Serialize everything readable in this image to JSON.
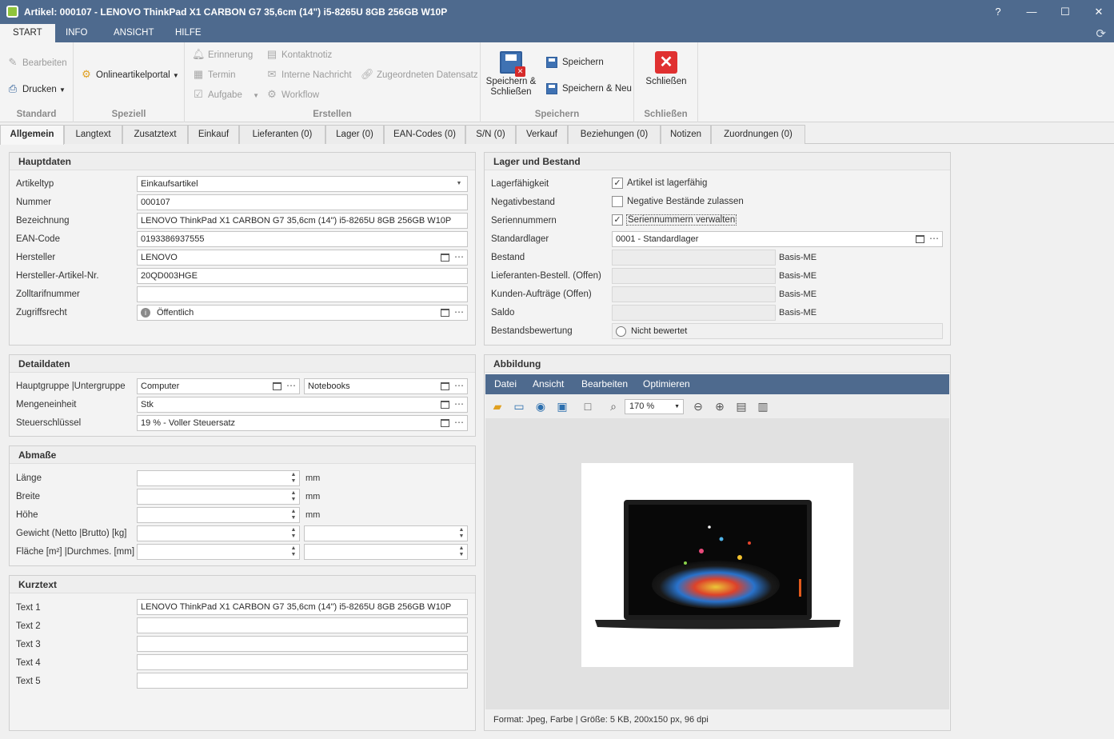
{
  "window": {
    "title": "Artikel: 000107 - LENOVO ThinkPad X1 CARBON G7 35,6cm (14\") i5-8265U 8GB 256GB W10P"
  },
  "menu": {
    "items": [
      {
        "label": "START"
      },
      {
        "label": "INFO"
      },
      {
        "label": "ANSICHT"
      },
      {
        "label": "HILFE"
      }
    ]
  },
  "ribbon": {
    "standard": {
      "title": "Standard",
      "edit": "Bearbeiten",
      "print": "Drucken"
    },
    "speziell": {
      "title": "Speziell",
      "portal": "Onlineartikelportal"
    },
    "erstellen": {
      "title": "Erstellen",
      "reminder": "Erinnerung",
      "appointment": "Termin",
      "task": "Aufgabe",
      "contact_note": "Kontaktnotiz",
      "internal_message": "Interne Nachricht",
      "assigned_record": "Zugeordneten Datensatz",
      "workflow": "Workflow"
    },
    "speichern": {
      "title": "Speichern",
      "save_close": "Speichern & Schließen",
      "save": "Speichern",
      "save_new": "Speichern & Neu"
    },
    "schliessen": {
      "title": "Schließen",
      "close": "Schließen"
    }
  },
  "tabs": [
    {
      "label": "Allgemein"
    },
    {
      "label": "Langtext"
    },
    {
      "label": "Zusatztext"
    },
    {
      "label": "Einkauf"
    },
    {
      "label": "Lieferanten (0)"
    },
    {
      "label": "Lager (0)"
    },
    {
      "label": "EAN-Codes (0)"
    },
    {
      "label": "S/N (0)"
    },
    {
      "label": "Verkauf"
    },
    {
      "label": "Beziehungen (0)"
    },
    {
      "label": "Notizen"
    },
    {
      "label": "Zuordnungen (0)"
    }
  ],
  "hauptdaten": {
    "title": "Hauptdaten",
    "artikeltyp": {
      "label": "Artikeltyp",
      "value": "Einkaufsartikel"
    },
    "nummer": {
      "label": "Nummer",
      "value": "000107"
    },
    "bezeichnung": {
      "label": "Bezeichnung",
      "value": "LENOVO ThinkPad X1 CARBON G7 35,6cm (14\") i5-8265U 8GB 256GB W10P"
    },
    "ean": {
      "label": "EAN-Code",
      "value": "0193386937555"
    },
    "hersteller": {
      "label": "Hersteller",
      "value": "LENOVO"
    },
    "hersteller_nr": {
      "label": "Hersteller-Artikel-Nr.",
      "value": "20QD003HGE"
    },
    "zolltarif": {
      "label": "Zolltarifnummer",
      "value": ""
    },
    "zugriffsrecht": {
      "label": "Zugriffsrecht",
      "value": "Öffentlich"
    }
  },
  "detaildaten": {
    "title": "Detaildaten",
    "gruppe": {
      "label": "Hauptgruppe |Untergruppe",
      "main": "Computer",
      "sub": "Notebooks"
    },
    "mengeneinheit": {
      "label": "Mengeneinheit",
      "value": "Stk"
    },
    "steuer": {
      "label": "Steuerschlüssel",
      "value": "19 % - Voller Steuersatz"
    }
  },
  "abmasse": {
    "title": "Abmaße",
    "laenge": {
      "label": "Länge",
      "unit": "mm"
    },
    "breite": {
      "label": "Breite",
      "unit": "mm"
    },
    "hoehe": {
      "label": "Höhe",
      "unit": "mm"
    },
    "gewicht": {
      "label": "Gewicht (Netto |Brutto) [kg]"
    },
    "flaeche": {
      "label": "Fläche [m²] |Durchmes. [mm]"
    }
  },
  "kurztext": {
    "title": "Kurztext",
    "texts": [
      {
        "label": "Text 1",
        "value": "LENOVO ThinkPad X1 CARBON G7 35,6cm (14\") i5-8265U 8GB 256GB W10P"
      },
      {
        "label": "Text 2",
        "value": ""
      },
      {
        "label": "Text 3",
        "value": ""
      },
      {
        "label": "Text 4",
        "value": ""
      },
      {
        "label": "Text 5",
        "value": ""
      }
    ]
  },
  "lager": {
    "title": "Lager und Bestand",
    "lagerfaehig": {
      "label": "Lagerfähigkeit",
      "check_label": "Artikel ist lagerfähig",
      "checked": true
    },
    "negativ": {
      "label": "Negativbestand",
      "check_label": "Negative Bestände zulassen",
      "checked": false
    },
    "seriennr": {
      "label": "Seriennummern",
      "check_label": "Seriennummern verwalten",
      "checked": true
    },
    "standardlager": {
      "label": "Standardlager",
      "value": "0001 - Standardlager"
    },
    "bestand": {
      "label": "Bestand",
      "unit": "Basis-ME"
    },
    "lief_bestell": {
      "label": "Lieferanten-Bestell. (Offen)",
      "unit": "Basis-ME"
    },
    "kunden_auftr": {
      "label": "Kunden-Aufträge (Offen)",
      "unit": "Basis-ME"
    },
    "saldo": {
      "label": "Saldo",
      "unit": "Basis-ME"
    },
    "bewertung": {
      "label": "Bestandsbewertung",
      "value": "Nicht bewertet"
    }
  },
  "abbildung": {
    "title": "Abbildung",
    "menu": [
      "Datei",
      "Ansicht",
      "Bearbeiten",
      "Optimieren"
    ],
    "zoom": "170 %",
    "status": "Format: Jpeg, Farbe   |   Größe: 5 KB, 200x150 px, 96 dpi"
  },
  "colors": {
    "accent": "#4e6a8e",
    "close_red": "#e03131",
    "save_blue": "#3f72b3"
  }
}
